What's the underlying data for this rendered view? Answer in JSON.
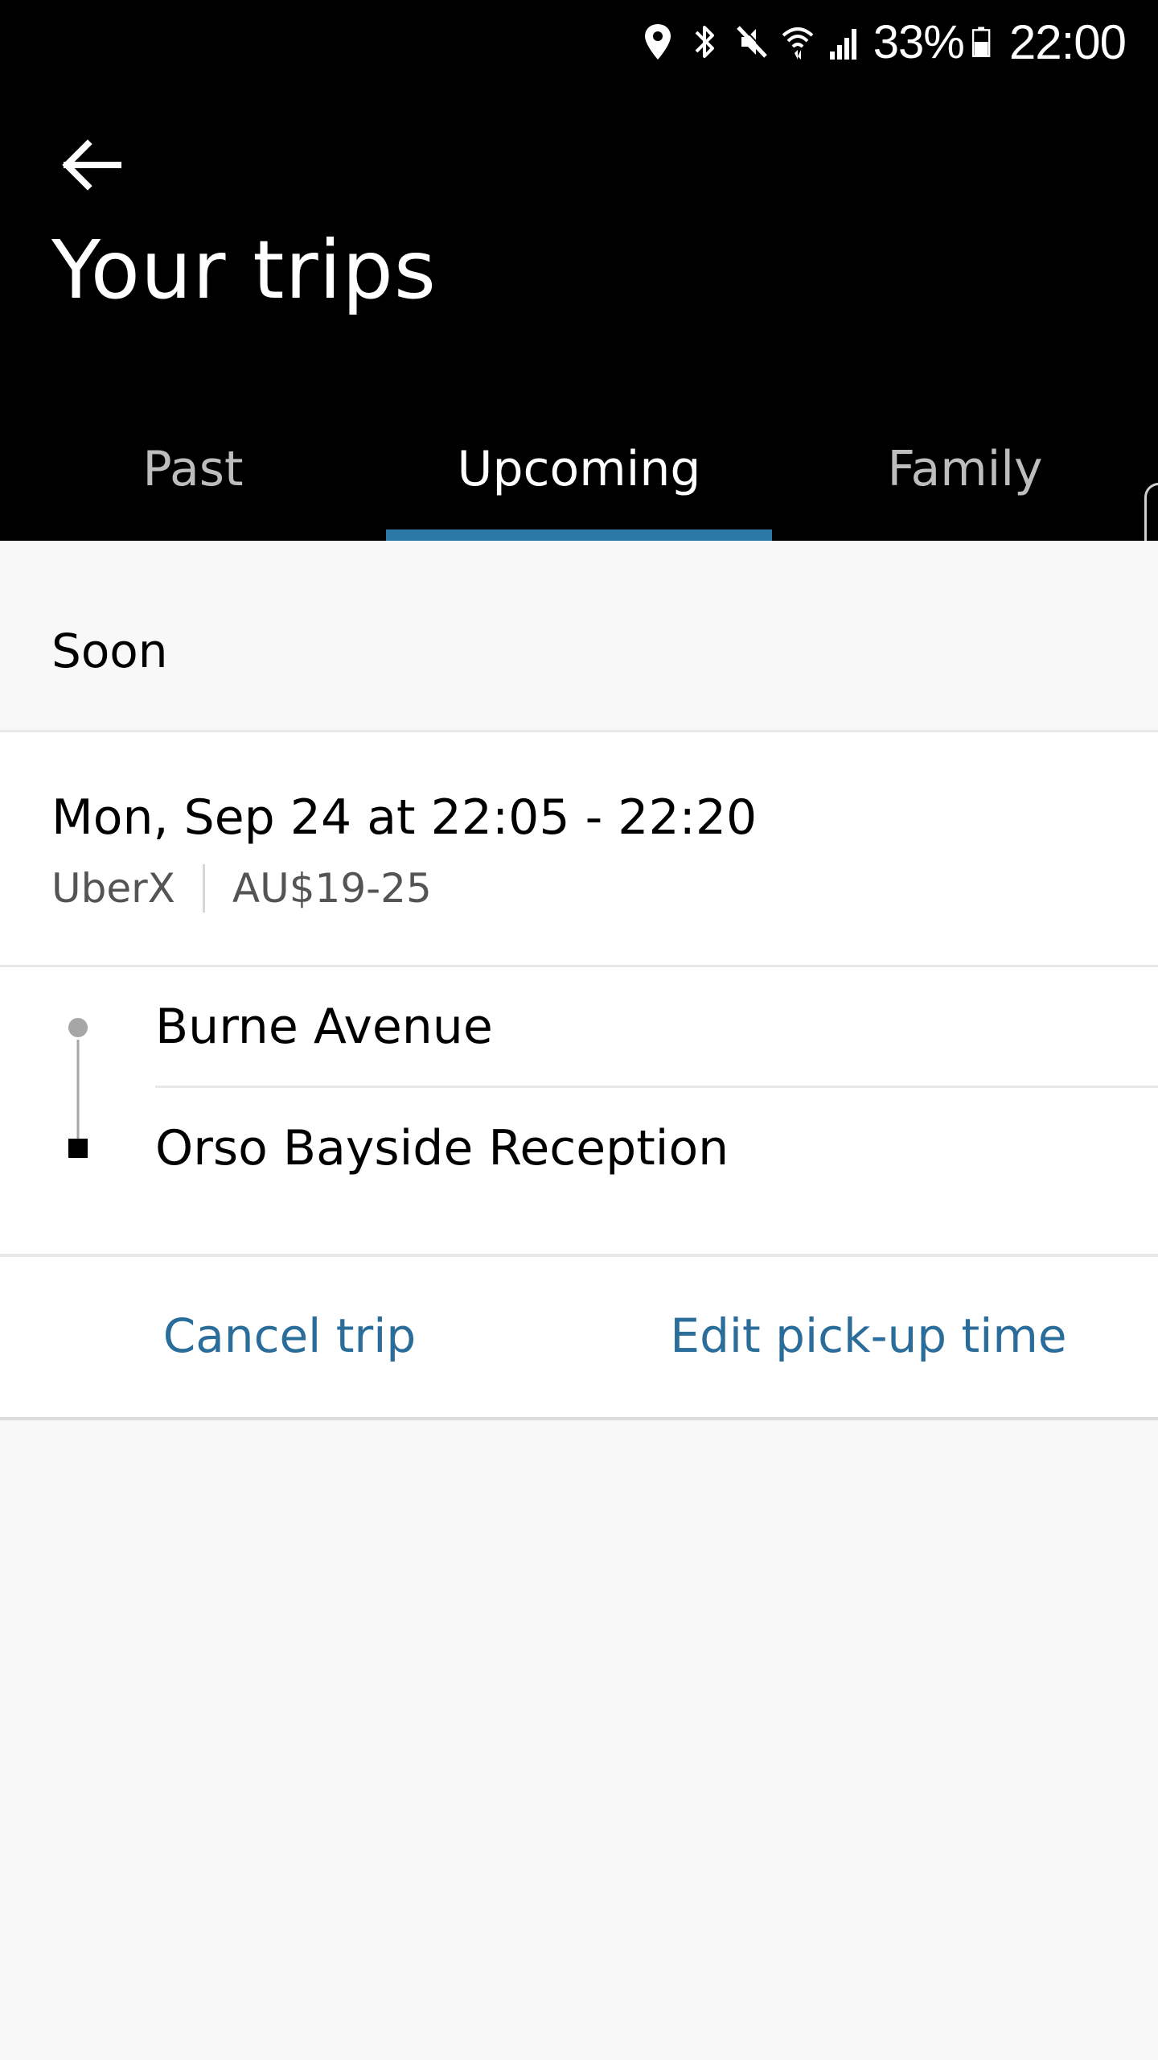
{
  "status_bar": {
    "battery": "33%",
    "time": "22:00",
    "icons": [
      "location-icon",
      "bluetooth-icon",
      "mute-icon",
      "wifi-icon",
      "signal-icon",
      "battery-icon"
    ]
  },
  "header": {
    "back_icon": "arrow-left-icon",
    "title": "Your trips"
  },
  "tabs": [
    {
      "label": "Past",
      "active": false
    },
    {
      "label": "Upcoming",
      "active": true
    },
    {
      "label": "Family",
      "active": false
    }
  ],
  "section": {
    "title": "Soon"
  },
  "trip": {
    "datetime": "Mon, Sep 24 at 22:05 - 22:20",
    "product": "UberX",
    "fare": "AU$19-25",
    "pickup": "Burne Avenue",
    "dropoff": "Orso Bayside Reception",
    "actions": {
      "cancel": "Cancel trip",
      "edit": "Edit pick-up time"
    }
  },
  "colors": {
    "header_bg": "#000000",
    "tab_indicator": "#2b79a6",
    "action_link": "#2b6d9a",
    "page_bg": "#f8f8f8"
  }
}
